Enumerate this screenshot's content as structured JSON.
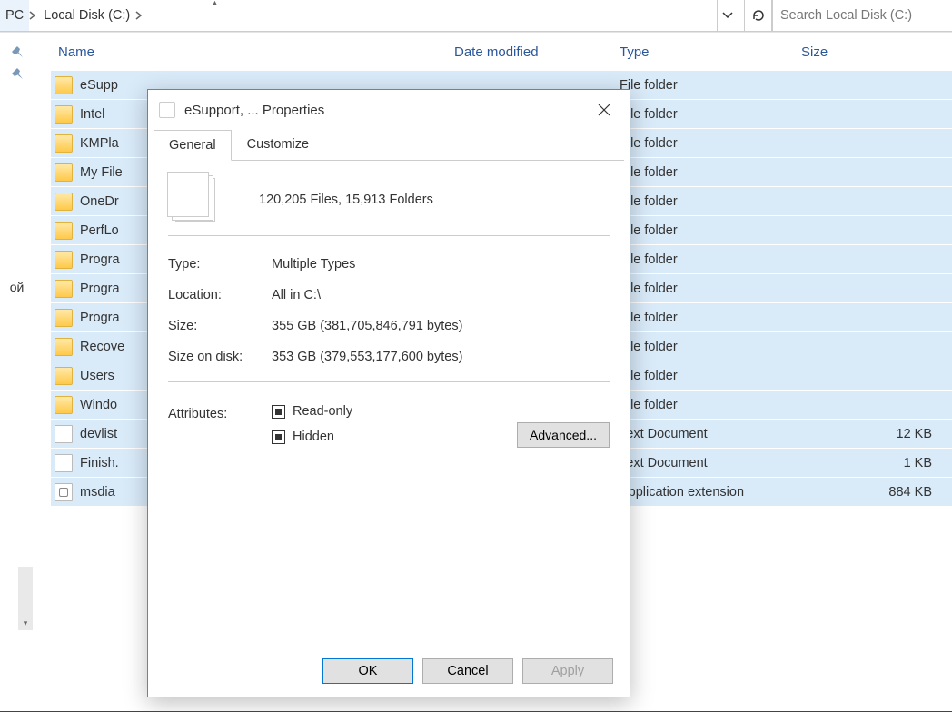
{
  "breadcrumb": {
    "pc": "PC",
    "disk": "Local Disk (C:)"
  },
  "search": {
    "placeholder": "Search Local Disk (C:)"
  },
  "sidebar_text": "ой",
  "columns": {
    "name": "Name",
    "date": "Date modified",
    "type": "Type",
    "size": "Size"
  },
  "files": [
    {
      "name": "eSupp",
      "kind": "folder",
      "type": "File folder",
      "size": ""
    },
    {
      "name": "Intel",
      "kind": "folder",
      "type": "File folder",
      "size": ""
    },
    {
      "name": "KMPla",
      "kind": "folder",
      "type": "File folder",
      "size": ""
    },
    {
      "name": "My File",
      "kind": "folder",
      "type": "File folder",
      "size": ""
    },
    {
      "name": "OneDr",
      "kind": "folder",
      "type": "File folder",
      "size": ""
    },
    {
      "name": "PerfLo",
      "kind": "folder",
      "type": "File folder",
      "size": ""
    },
    {
      "name": "Progra",
      "kind": "folder",
      "type": "File folder",
      "size": ""
    },
    {
      "name": "Progra",
      "kind": "folder",
      "type": "File folder",
      "size": ""
    },
    {
      "name": "Progra",
      "kind": "folder",
      "type": "File folder",
      "size": ""
    },
    {
      "name": "Recove",
      "kind": "folder",
      "type": "File folder",
      "size": ""
    },
    {
      "name": "Users",
      "kind": "folder",
      "type": "File folder",
      "size": ""
    },
    {
      "name": "Windo",
      "kind": "folder",
      "type": "File folder",
      "size": ""
    },
    {
      "name": "devlist",
      "kind": "file",
      "type": "Text Document",
      "size": "12 KB"
    },
    {
      "name": "Finish.",
      "kind": "file",
      "type": "Text Document",
      "size": "1 KB"
    },
    {
      "name": "msdia",
      "kind": "dll",
      "type": "Application extension",
      "size": "884 KB"
    }
  ],
  "dialog": {
    "title": "eSupport, ... Properties",
    "tabs": {
      "general": "General",
      "customize": "Customize"
    },
    "summary": "120,205 Files, 15,913 Folders",
    "kv": {
      "type_label": "Type:",
      "type_value": "Multiple Types",
      "location_label": "Location:",
      "location_value": "All in C:\\",
      "size_label": "Size:",
      "size_value": "355 GB (381,705,846,791 bytes)",
      "sod_label": "Size on disk:",
      "sod_value": "353 GB (379,553,177,600 bytes)"
    },
    "attributes_label": "Attributes:",
    "readonly_label": "Read-only",
    "hidden_label": "Hidden",
    "advanced_label": "Advanced...",
    "ok": "OK",
    "cancel": "Cancel",
    "apply": "Apply"
  }
}
